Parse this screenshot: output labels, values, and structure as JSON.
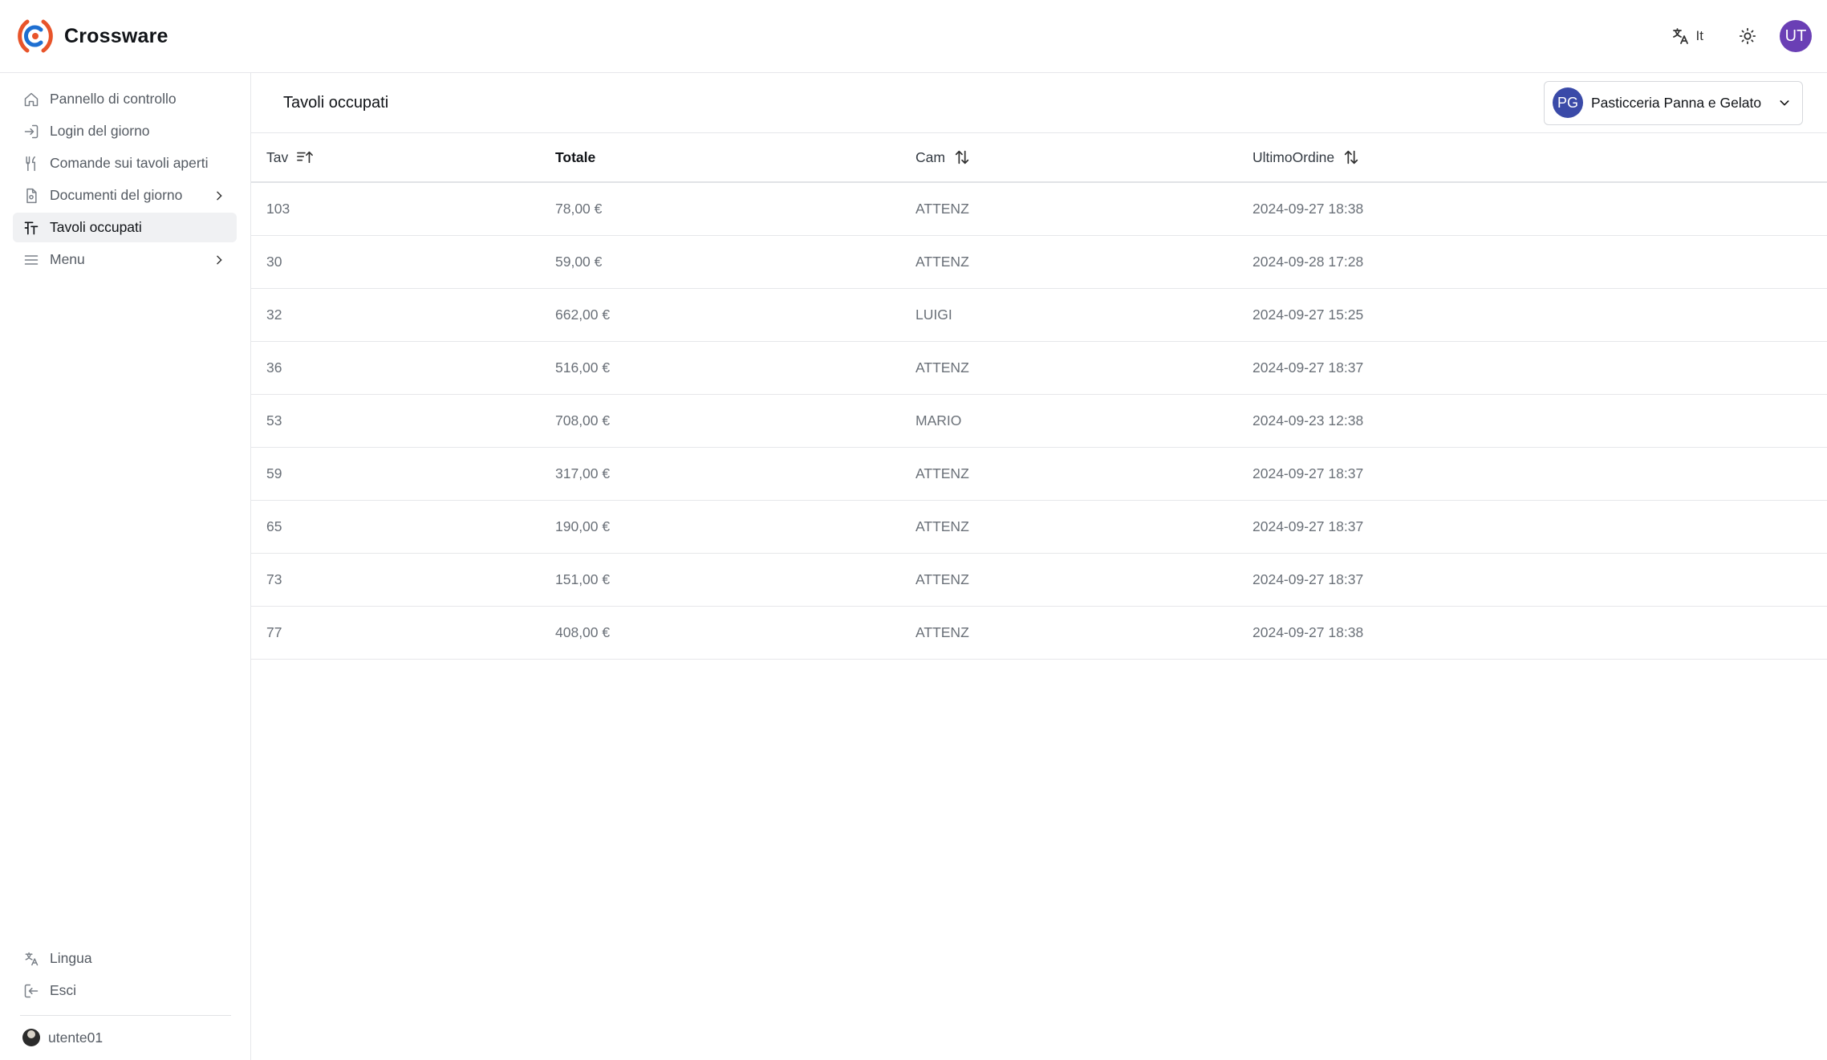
{
  "brand": {
    "name": "Crossware",
    "logo_colors": {
      "ring": "#e8542a",
      "center": "#1e6fd1"
    }
  },
  "header": {
    "language_label": "It",
    "avatar_initials": "UT",
    "avatar_color": "#6a3fb5"
  },
  "sidebar": {
    "items": [
      {
        "label": "Pannello di controllo",
        "icon": "home-icon"
      },
      {
        "label": "Login del giorno",
        "icon": "login-icon"
      },
      {
        "label": "Comande sui tavoli aperti",
        "icon": "utensils-icon"
      },
      {
        "label": "Documenti del giorno",
        "icon": "document-icon",
        "has_submenu": true
      },
      {
        "label": "Tavoli occupati",
        "icon": "table-icon",
        "active": true
      },
      {
        "label": "Menu",
        "icon": "menu-icon",
        "has_submenu": true
      }
    ],
    "bottom": [
      {
        "label": "Lingua",
        "icon": "language-icon"
      },
      {
        "label": "Esci",
        "icon": "logout-icon"
      }
    ],
    "user": {
      "name": "utente01"
    }
  },
  "main": {
    "title": "Tavoli occupati",
    "store": {
      "initials": "PG",
      "name": "Pasticceria Panna e Gelato",
      "avatar_color": "#3a4aa8"
    },
    "table": {
      "headers": {
        "tav": "Tav",
        "totale": "Totale",
        "cam": "Cam",
        "ultimo_ordine": "UltimoOrdine"
      },
      "rows": [
        {
          "tav": "103",
          "totale": "78,00 €",
          "cam": "ATTENZ",
          "ultimo_ordine": "2024-09-27 18:38"
        },
        {
          "tav": "30",
          "totale": "59,00 €",
          "cam": "ATTENZ",
          "ultimo_ordine": "2024-09-28 17:28"
        },
        {
          "tav": "32",
          "totale": "662,00 €",
          "cam": "LUIGI",
          "ultimo_ordine": "2024-09-27 15:25"
        },
        {
          "tav": "36",
          "totale": "516,00 €",
          "cam": "ATTENZ",
          "ultimo_ordine": "2024-09-27 18:37"
        },
        {
          "tav": "53",
          "totale": "708,00 €",
          "cam": "MARIO",
          "ultimo_ordine": "2024-09-23 12:38"
        },
        {
          "tav": "59",
          "totale": "317,00 €",
          "cam": "ATTENZ",
          "ultimo_ordine": "2024-09-27 18:37"
        },
        {
          "tav": "65",
          "totale": "190,00 €",
          "cam": "ATTENZ",
          "ultimo_ordine": "2024-09-27 18:37"
        },
        {
          "tav": "73",
          "totale": "151,00 €",
          "cam": "ATTENZ",
          "ultimo_ordine": "2024-09-27 18:37"
        },
        {
          "tav": "77",
          "totale": "408,00 €",
          "cam": "ATTENZ",
          "ultimo_ordine": "2024-09-27 18:38"
        }
      ]
    }
  }
}
